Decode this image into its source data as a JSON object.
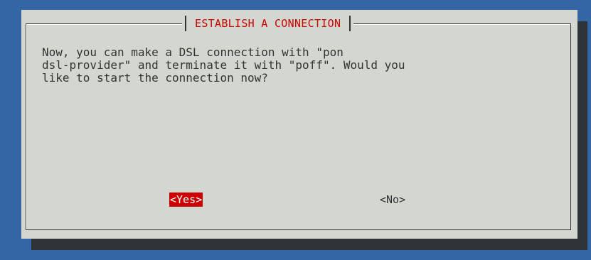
{
  "dialog": {
    "title": "ESTABLISH A CONNECTION",
    "message": "Now, you can make a DSL connection with \"pon\ndsl-provider\" and terminate it with \"poff\". Would you\nlike to start the connection now?",
    "buttons": {
      "yes": "<Yes>",
      "no": "<No>"
    }
  },
  "colors": {
    "background": "#3465a4",
    "dialog": "#d3d7cf",
    "shadow": "#2e3436",
    "accent": "#cc0000"
  }
}
